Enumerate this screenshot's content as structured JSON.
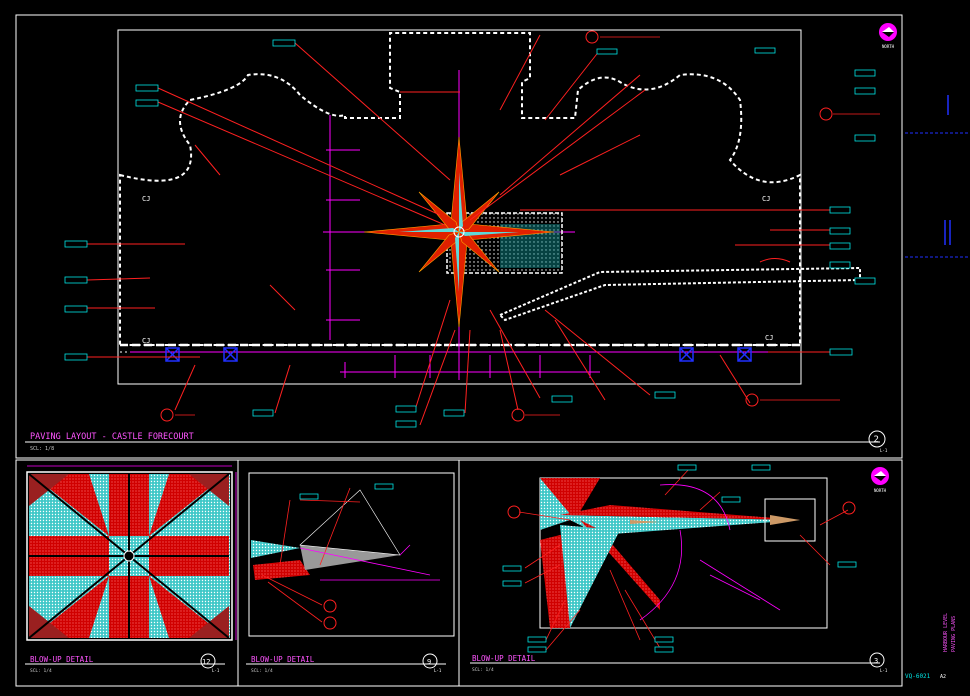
{
  "colors": {
    "background": "#000000",
    "border": "#ffffff",
    "leader": "#ff2020",
    "tag": "#00e5e5",
    "dimension": "#ff00ff",
    "star_red": "#dd1a00",
    "star_cyan": "#5fd8d8",
    "blue_marker": "#2030ff"
  },
  "main_view": {
    "title": "PAVING LAYOUT - CASTLE FORECOURT",
    "scale_note": "SCL: 1/8",
    "detail_number": "2",
    "sheet_ref": "L-1",
    "zone_mark": "CJ"
  },
  "details": [
    {
      "title": "BLOW-UP DETAIL",
      "scale_note": "SCL: 1/4",
      "detail_number": "12",
      "sheet_ref": "L-1"
    },
    {
      "title": "BLOW-UP DETAIL",
      "scale_note": "SCL: 1/4",
      "detail_number": "9",
      "sheet_ref": "L-1"
    },
    {
      "title": "BLOW-UP DETAIL",
      "scale_note": "SCL: 1/4",
      "detail_number": "3",
      "sheet_ref": "L-1"
    }
  ],
  "north_arrow": {
    "label": "NORTH"
  },
  "title_block": {
    "project_line1": "HARBOUR LEVEL",
    "project_line2": "PAVING PLANS",
    "sheet_number": "VQ-6021",
    "sheet_index": "A2"
  }
}
